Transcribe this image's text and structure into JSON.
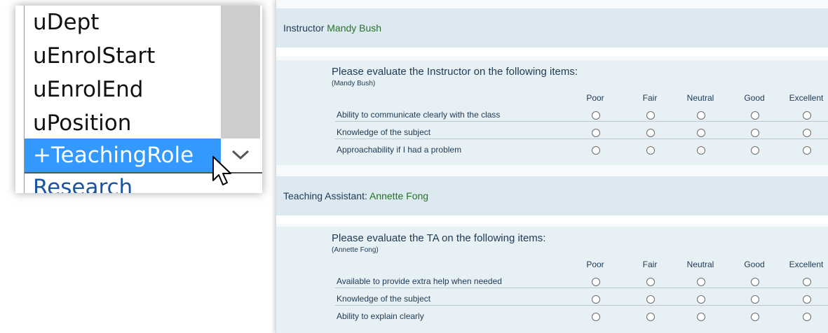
{
  "dropdown": {
    "items": [
      "uDept",
      "uEnrolStart",
      "uEnrolEnd",
      "uPosition",
      "+TeachingRole",
      "Research"
    ],
    "selected_index": 4,
    "icons": {
      "scroll_down": "chevron-down-icon",
      "cursor": "mouse-pointer-icon"
    }
  },
  "form": {
    "columns": [
      "Poor",
      "Fair",
      "Neutral",
      "Good",
      "Excellent"
    ],
    "instructor": {
      "header_label": "Instructor",
      "name": "Mandy Bush",
      "question": "Please evaluate the Instructor on the following items:",
      "subtitle": "(Mandy Bush)",
      "items": [
        "Ability to communicate clearly with the class",
        "Knowledge of the subject",
        "Approachability if I had a problem"
      ]
    },
    "ta": {
      "header_label": "Teaching Assistant:",
      "name": "Annette Fong",
      "question": "Please evaluate the TA on the following items:",
      "subtitle": "(Annette Fong)",
      "items": [
        "Available to provide extra help when needed",
        "Knowledge of the subject",
        "Ability to explain clearly"
      ]
    }
  }
}
